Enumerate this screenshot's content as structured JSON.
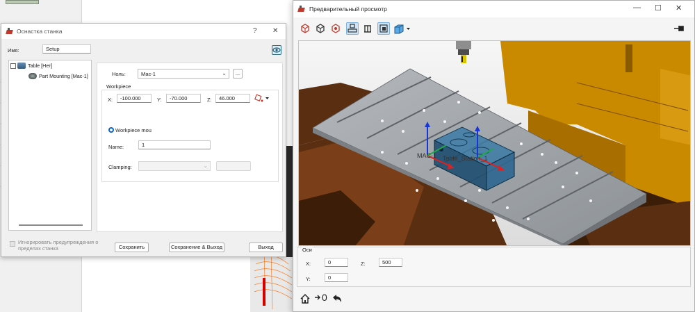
{
  "setup_dialog": {
    "title": "Оснастка станка",
    "help_icon": "?",
    "close_icon": "✕",
    "name_label": "Имя:",
    "name_value": "Setup",
    "tree": {
      "items": [
        {
          "label": "Table [Нет]",
          "icon": "table-icon"
        },
        {
          "label": "Part Mounting [Мас-1]",
          "icon": "part-mounting-icon"
        }
      ]
    },
    "zero_label": "Ноль:",
    "zero_value": "Мас-1",
    "zero_button": "...",
    "workpiece": {
      "group_title": "Workpiece",
      "x_label": "X:",
      "x_value": "-100.000",
      "y_label": "Y:",
      "y_value": "-70.000",
      "z_label": "Z:",
      "z_value": "46.000",
      "radio_label": "Workpiece mou",
      "name_label": "Name:",
      "name_value": "1",
      "clamping_label": "Clamping:",
      "clamping_value": ""
    },
    "ignore_warnings_label": "Игнорировать предупреждения о пределах станка",
    "save_button": "Сохранить",
    "save_exit_button": "Сохранение & Выход",
    "exit_button": "Выход"
  },
  "preview_window": {
    "title": "Предварительный просмотр",
    "minimize": "—",
    "maximize": "☐",
    "close": "✕",
    "toolbar_icons": [
      "view-isometric-icon",
      "view-side-icon",
      "view-back-icon",
      "machine-table-icon",
      "fixtures-icon",
      "workpiece-icon",
      "display-mode-icon"
    ],
    "pin_icon": "pin-icon",
    "scene": {
      "label_mac": "MAC-1",
      "label_table": "Table_Station_1"
    },
    "axes": {
      "title": "Оси",
      "x_label": "X:",
      "x_value": "0",
      "z_label": "Z:",
      "z_value": "500",
      "y_label": "Y:",
      "y_value": "0"
    },
    "bottom_icons": [
      "home-icon",
      "zero-arrow-icon",
      "undo-icon"
    ],
    "zero_text": "0"
  },
  "colors": {
    "machine_orange": "#c98a00",
    "table_gray": "#8e9398",
    "fixture_blue": "#3d7ba6",
    "axis_x": "#e02020",
    "axis_y": "#1fa84a",
    "axis_z": "#1836d8",
    "accent": "#0a64c8"
  }
}
